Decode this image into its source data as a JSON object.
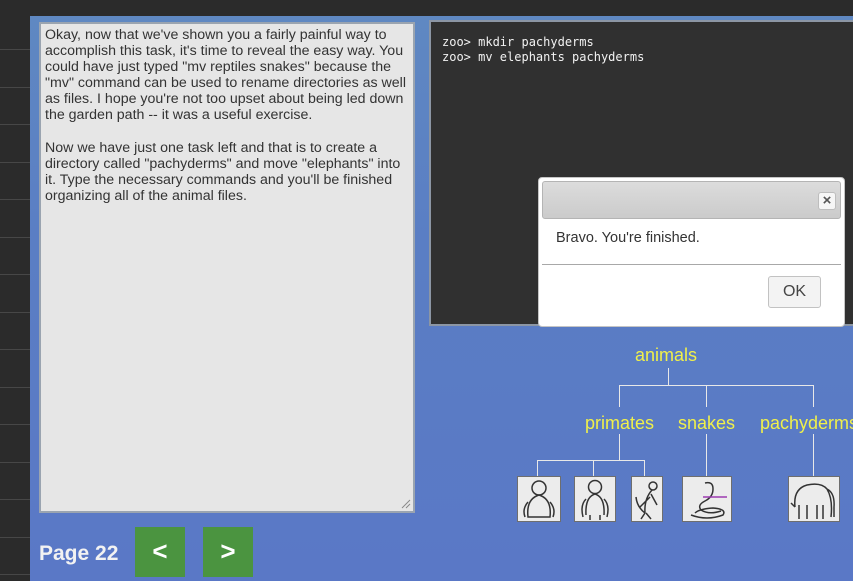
{
  "lesson": {
    "paragraph1": "Okay, now that we've shown you a fairly painful way to accomplish this task, it's time to reveal the easy way. You could have just typed \"mv reptiles snakes\" because the \"mv\" command can be used to rename directories as well as files. I hope you're not too upset about being led down the garden path -- it was a useful exercise.",
    "paragraph2": "Now we have just one task left and that is to create a directory called \"pachyderms\" and move \"elephants\" into it. Type the necessary commands and you'll be finished organizing all of the animal files."
  },
  "terminal": {
    "lines": [
      "zoo> mkdir pachyderms",
      "zoo> mv elephants pachyderms"
    ]
  },
  "dialog": {
    "close_symbol": "×",
    "message": "Bravo. You're finished.",
    "ok_label": "OK"
  },
  "tree": {
    "root": "animals",
    "children": [
      "primates",
      "snakes",
      "pachyderms"
    ],
    "leaves": [
      {
        "parent": "primates",
        "icon": "gorilla-icon"
      },
      {
        "parent": "primates",
        "icon": "ape-icon"
      },
      {
        "parent": "primates",
        "icon": "monkey-icon"
      },
      {
        "parent": "snakes",
        "icon": "cobra-icon"
      },
      {
        "parent": "pachyderms",
        "icon": "elephant-icon"
      }
    ]
  },
  "pager": {
    "label": "Page 22",
    "prev_label": "<",
    "next_label": ">"
  },
  "colors": {
    "background_blue": "#5a7ec4",
    "tree_label_yellow": "#f0f04a",
    "nav_green": "#4b9440",
    "terminal_bg": "#303030"
  }
}
